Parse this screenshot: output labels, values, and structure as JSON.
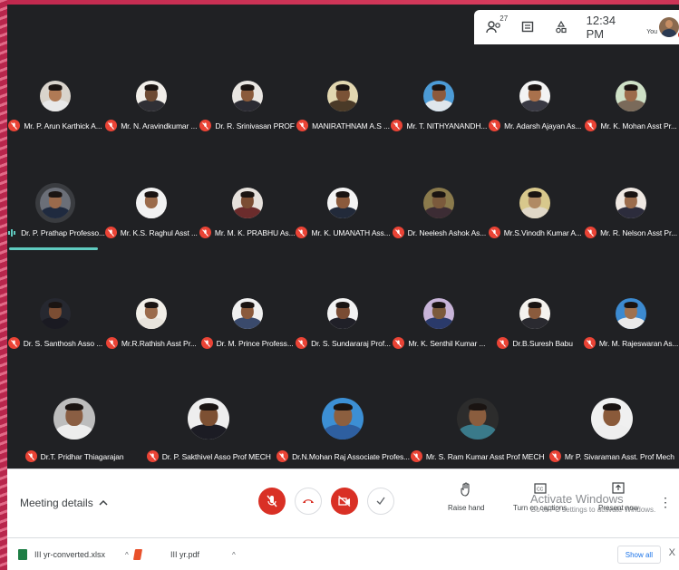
{
  "topbar": {
    "participants_count": "27",
    "time": "12:34 PM",
    "you_label": "You",
    "icons": [
      "people-icon",
      "chat-icon",
      "activities-icon"
    ]
  },
  "participants": [
    {
      "name": "Mr. P. Arun Karthick A...",
      "muted": true
    },
    {
      "name": "Mr. N. Aravindkumar ...",
      "muted": true
    },
    {
      "name": "Dr. R. Srinivasan PROF",
      "muted": true
    },
    {
      "name": "MANIRATHNAM A.S ...",
      "muted": true
    },
    {
      "name": "Mr. T. NITHYANANDH...",
      "muted": true
    },
    {
      "name": "Mr. Adarsh Ajayan As...",
      "muted": true
    },
    {
      "name": "Mr. K. Mohan Asst Pr...",
      "muted": true
    },
    {
      "name": "Dr. P. Prathap Professo...",
      "muted": false,
      "speaking": true
    },
    {
      "name": "Mr. K.S. Raghul Asst ...",
      "muted": true
    },
    {
      "name": "Mr. M. K. PRABHU As...",
      "muted": true
    },
    {
      "name": "Mr. K. UMANATH Ass...",
      "muted": true
    },
    {
      "name": "Dr. Neelesh Ashok As...",
      "muted": true
    },
    {
      "name": "Mr.S.Vinodh Kumar A...",
      "muted": true
    },
    {
      "name": "Mr. R. Nelson Asst Pr...",
      "muted": true
    },
    {
      "name": "Dr. S. Santhosh Asso ...",
      "muted": true
    },
    {
      "name": "Mr.R.Rathish Asst Pr...",
      "muted": true
    },
    {
      "name": "Dr. M. Prince Profess...",
      "muted": true
    },
    {
      "name": "Dr. S. Sundararaj Prof...",
      "muted": true
    },
    {
      "name": "Mr. K. Senthil Kumar ...",
      "muted": true
    },
    {
      "name": "Dr.B.Suresh Babu",
      "muted": true
    },
    {
      "name": "Mr. M. Rajeswaran As...",
      "muted": true
    },
    {
      "name": "Dr.T. Pridhar Thiagarajan",
      "muted": true
    },
    {
      "name": "Dr. P. Sakthivel Asso Prof MECH",
      "muted": true
    },
    {
      "name": "Dr.N.Mohan Raj Associate Profes...",
      "muted": true
    },
    {
      "name": "Mr. S. Ram Kumar Asst Prof MECH",
      "muted": true
    },
    {
      "name": "Mr P. Sivaraman Asst. Prof Mech",
      "muted": true
    }
  ],
  "controls": {
    "meeting_details": "Meeting details",
    "raise_hand": "Raise hand",
    "turn_on_captions": "Turn on captions",
    "present_now": "Present now",
    "watermark_title": "Activate Windows",
    "watermark_sub": "Go to PC settings to activate Windows."
  },
  "downloads": {
    "items": [
      {
        "name": "III yr-converted.xlsx"
      },
      {
        "name": "III yr.pdf"
      }
    ],
    "show_all": "Show all",
    "close": "X"
  },
  "colors": {
    "meet_bg": "#202124",
    "mute_red": "#ea4335",
    "speaking_teal": "#5fcbc0",
    "end_call_red": "#d93025"
  }
}
